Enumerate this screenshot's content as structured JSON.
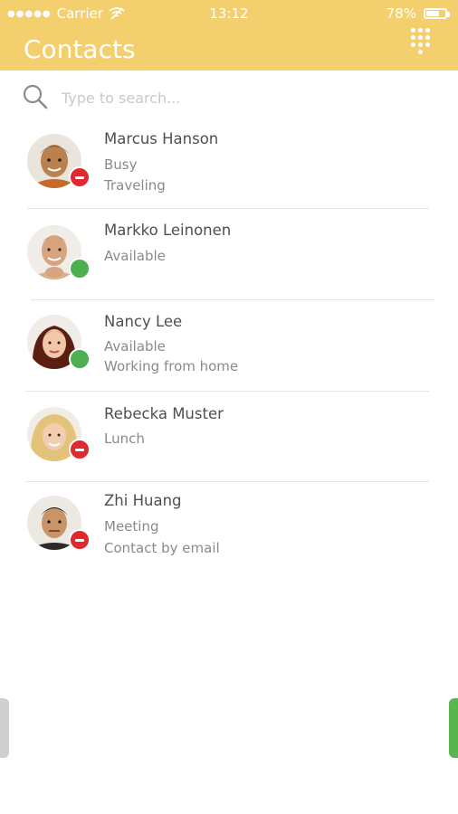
{
  "status_bar": {
    "signal_dots": "●●●●●",
    "carrier": "Carrier",
    "wifi_icon": "no-wifi-icon",
    "time": "13:12",
    "battery_percent": "78%",
    "battery_level": 0.78
  },
  "header": {
    "title": "Contacts",
    "dialpad_icon": "dialpad-icon",
    "color": "#f3cf6e"
  },
  "search": {
    "placeholder": "Type to search..."
  },
  "contacts": [
    {
      "name": "Marcus Hanson",
      "status": "busy",
      "line1": "Busy",
      "line2": "Traveling"
    },
    {
      "name": "Markko Leinonen",
      "status": "available",
      "line1": "Available",
      "line2": ""
    },
    {
      "name": "Nancy Lee",
      "status": "available",
      "line1": "Available",
      "line2": "Working from home"
    },
    {
      "name": "Rebecka Muster",
      "status": "busy",
      "line1": "Lunch",
      "line2": ""
    },
    {
      "name": "Zhi Huang",
      "status": "busy",
      "line1": "Meeting",
      "line2": "Contact by email"
    }
  ],
  "colors": {
    "busy": "#e0292e",
    "available": "#4caf50"
  }
}
